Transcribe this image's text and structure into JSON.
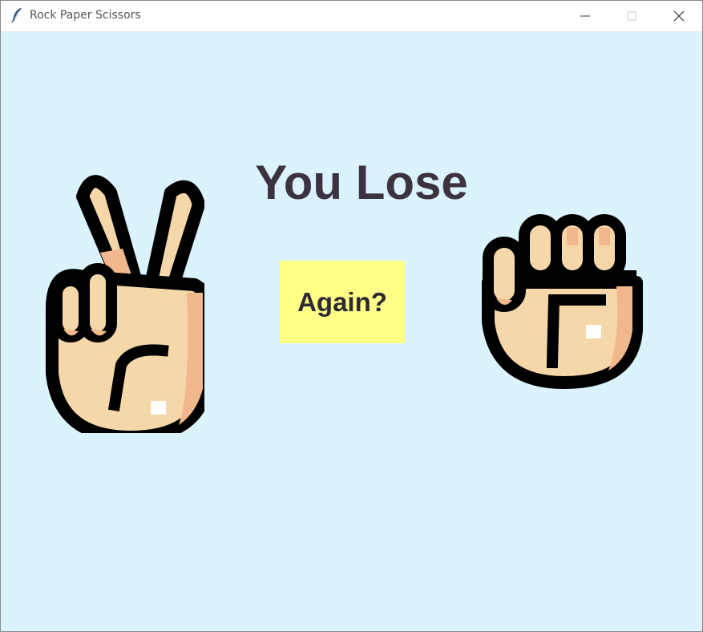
{
  "window": {
    "title": "Rock Paper Scissors"
  },
  "game": {
    "result": "You Lose",
    "again_label": "Again?",
    "player_choice_icon": "scissors-hand-icon",
    "computer_choice_icon": "rock-fist-icon"
  },
  "colors": {
    "background": "#dbf3ff",
    "button": "#ffff88",
    "result_text": "#3d3340",
    "skin": "#f5d7a9",
    "skin_shadow": "#f0b88c",
    "outline": "#000000"
  }
}
